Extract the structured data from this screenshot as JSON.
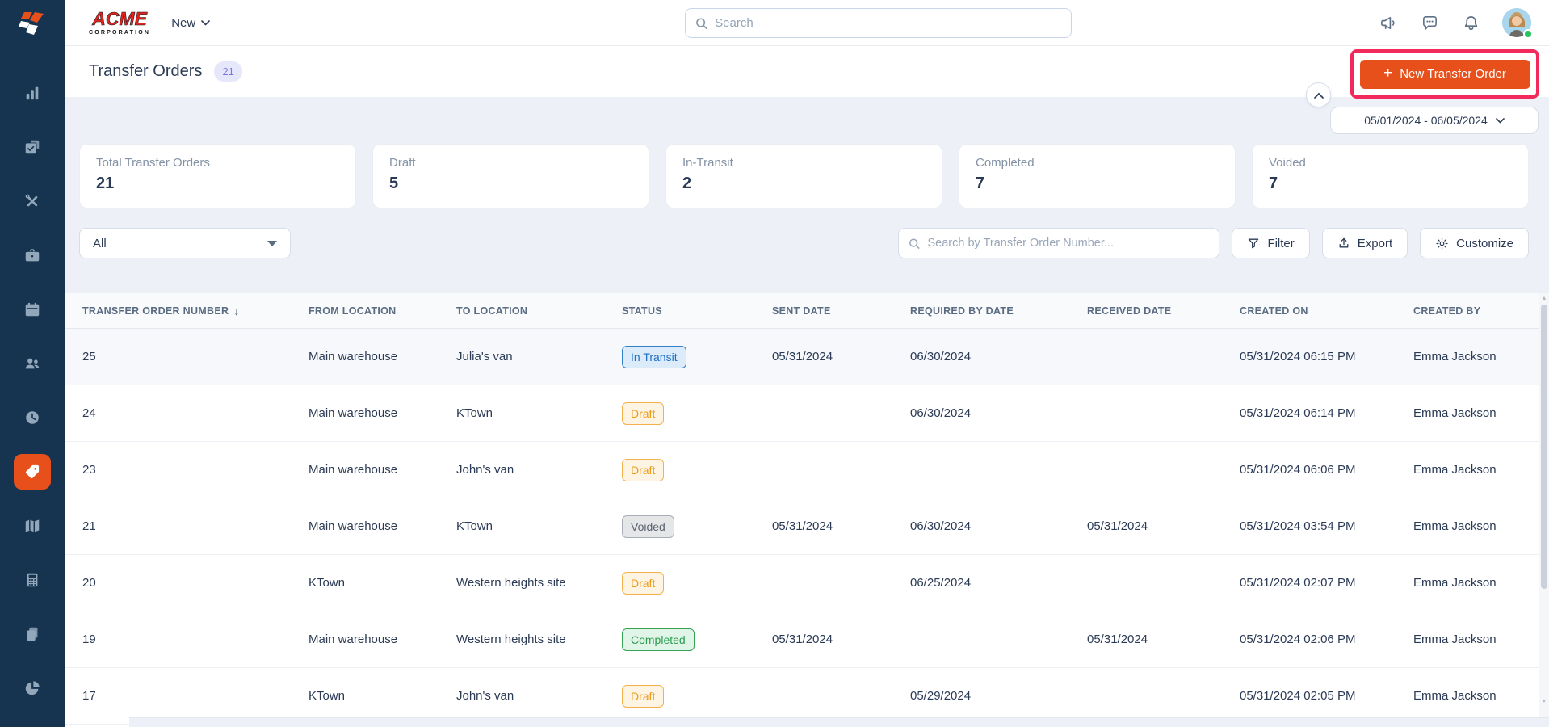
{
  "brand": {
    "logo_line1": "ACME",
    "logo_line2": "CORPORATION"
  },
  "topbar": {
    "new_menu_label": "New",
    "search_placeholder": "Search"
  },
  "page": {
    "title": "Transfer Orders",
    "count": "21",
    "new_button_label": "New Transfer Order",
    "new_button_plus": "+",
    "date_range": "05/01/2024 - 06/05/2024"
  },
  "summary_cards": [
    {
      "label": "Total Transfer Orders",
      "value": "21"
    },
    {
      "label": "Draft",
      "value": "5"
    },
    {
      "label": "In-Transit",
      "value": "2"
    },
    {
      "label": "Completed",
      "value": "7"
    },
    {
      "label": "Voided",
      "value": "7"
    }
  ],
  "toolbar": {
    "type_filter_value": "All",
    "search_placeholder": "Search by Transfer Order Number...",
    "filter_label": "Filter",
    "export_label": "Export",
    "customize_label": "Customize"
  },
  "table": {
    "columns": [
      "TRANSFER ORDER NUMBER",
      "FROM LOCATION",
      "TO LOCATION",
      "STATUS",
      "SENT DATE",
      "REQUIRED BY DATE",
      "RECEIVED DATE",
      "CREATED ON",
      "CREATED BY"
    ],
    "sort_arrow": "↓",
    "rows": [
      {
        "number": "25",
        "from": "Main warehouse",
        "to": "Julia's van",
        "status": "In Transit",
        "sent": "05/31/2024",
        "required": "06/30/2024",
        "received": "",
        "created_on": "05/31/2024 06:15 PM",
        "created_by": "Emma Jackson"
      },
      {
        "number": "24",
        "from": "Main warehouse",
        "to": "KTown",
        "status": "Draft",
        "sent": "",
        "required": "06/30/2024",
        "received": "",
        "created_on": "05/31/2024 06:14 PM",
        "created_by": "Emma Jackson"
      },
      {
        "number": "23",
        "from": "Main warehouse",
        "to": "John's van",
        "status": "Draft",
        "sent": "",
        "required": "",
        "received": "",
        "created_on": "05/31/2024 06:06 PM",
        "created_by": "Emma Jackson"
      },
      {
        "number": "21",
        "from": "Main warehouse",
        "to": "KTown",
        "status": "Voided",
        "sent": "05/31/2024",
        "required": "06/30/2024",
        "received": "05/31/2024",
        "created_on": "05/31/2024 03:54 PM",
        "created_by": "Emma Jackson"
      },
      {
        "number": "20",
        "from": "KTown",
        "to": "Western heights site",
        "status": "Draft",
        "sent": "",
        "required": "06/25/2024",
        "received": "",
        "created_on": "05/31/2024 02:07 PM",
        "created_by": "Emma Jackson"
      },
      {
        "number": "19",
        "from": "Main warehouse",
        "to": "Western heights site",
        "status": "Completed",
        "sent": "05/31/2024",
        "required": "",
        "received": "05/31/2024",
        "created_on": "05/31/2024 02:06 PM",
        "created_by": "Emma Jackson"
      },
      {
        "number": "17",
        "from": "KTown",
        "to": "John's van",
        "status": "Draft",
        "sent": "",
        "required": "05/29/2024",
        "received": "",
        "created_on": "05/31/2024 02:05 PM",
        "created_by": "Emma Jackson"
      }
    ]
  },
  "status_styles": {
    "In Transit": {
      "bg": "#DCEBF9",
      "border": "#2F7FC9",
      "text": "#1E6FC5"
    },
    "Draft": {
      "bg": "#FDF4E3",
      "border": "#F3B04C",
      "text": "#EE9A16"
    },
    "Voided": {
      "bg": "#E5E6E8",
      "border": "#A9AEB6",
      "text": "#5C6370"
    },
    "Completed": {
      "bg": "#E1F4E8",
      "border": "#33A456",
      "text": "#2B9D50"
    }
  },
  "icons": {
    "sidebar": [
      "bar-chart",
      "clipboard-tasks",
      "tools",
      "briefcase",
      "calendar",
      "users",
      "clock",
      "tag",
      "map",
      "calculator",
      "documents",
      "pie-chart"
    ],
    "topbar": [
      "megaphone",
      "chat",
      "bell"
    ]
  },
  "colors": {
    "accent_orange": "#E8501B",
    "annotation_pink": "#F2295B",
    "sidebar_bg": "#16334F"
  }
}
